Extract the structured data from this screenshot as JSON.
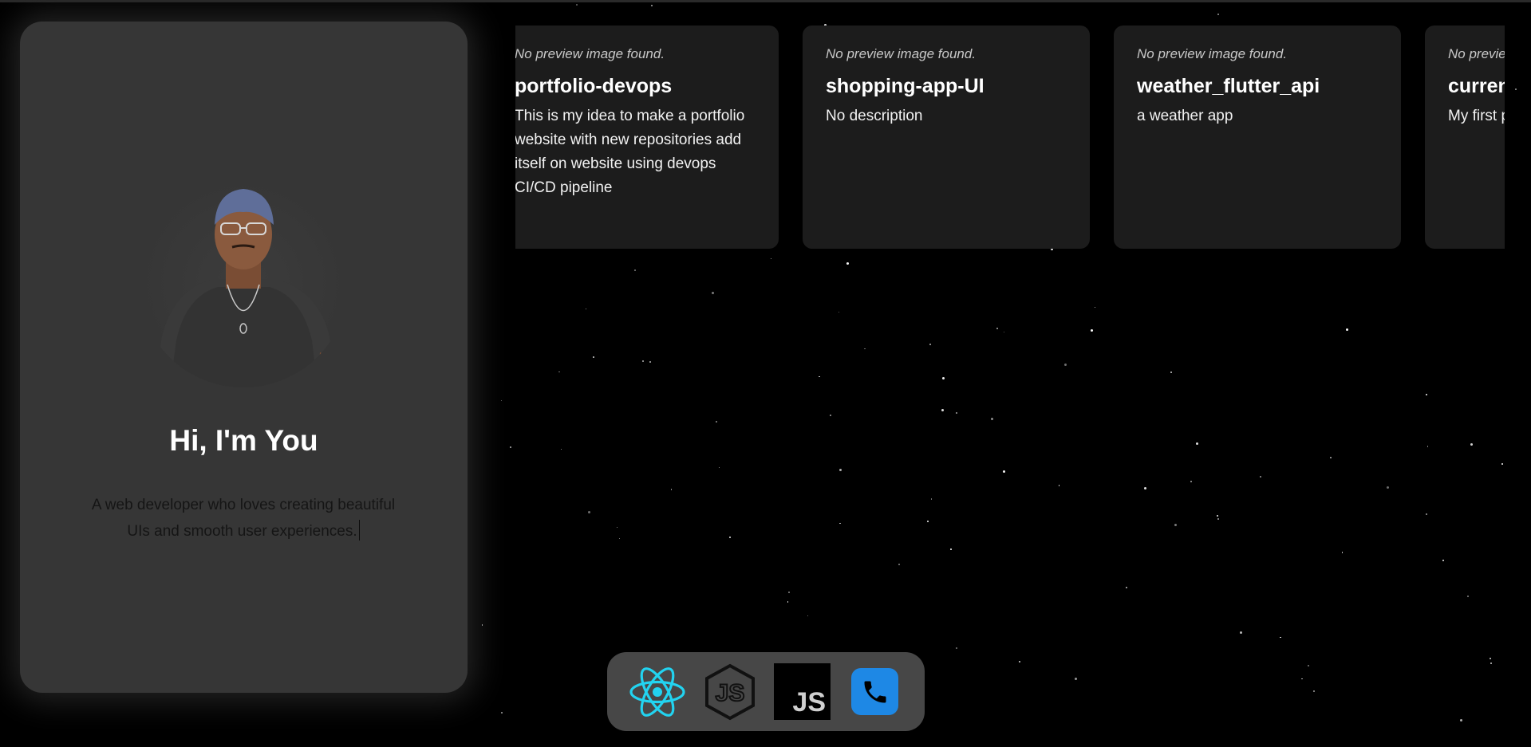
{
  "profile": {
    "title": "Hi, I'm You",
    "subtitle": "A web developer who loves creating beautiful UIs and smooth user experiences."
  },
  "repos": [
    {
      "preview_text": "No preview image found.",
      "name": "portfolio-devops",
      "description": "This is my idea to make a portfolio website with new repositories add itself on website using devops CI/CD pipeline"
    },
    {
      "preview_text": "No preview image found.",
      "name": "shopping-app-UI",
      "description": "No description"
    },
    {
      "preview_text": "No preview image found.",
      "name": "weather_flutter_api",
      "description": "a weather app"
    },
    {
      "preview_text": "No preview image found.",
      "name": "currency-converter",
      "description": "My first project"
    }
  ],
  "dock": {
    "items": [
      {
        "icon": "react-icon",
        "color": "#22d3f0"
      },
      {
        "icon": "nodejs-icon",
        "color": "#111111"
      },
      {
        "icon": "javascript-icon",
        "label": "JS",
        "color": "#000000"
      },
      {
        "icon": "phone-icon",
        "color": "#1e88e5"
      }
    ]
  },
  "colors": {
    "background": "#000000",
    "card": "#363636",
    "repo_card": "#1c1c1c",
    "dock": "#474747"
  }
}
